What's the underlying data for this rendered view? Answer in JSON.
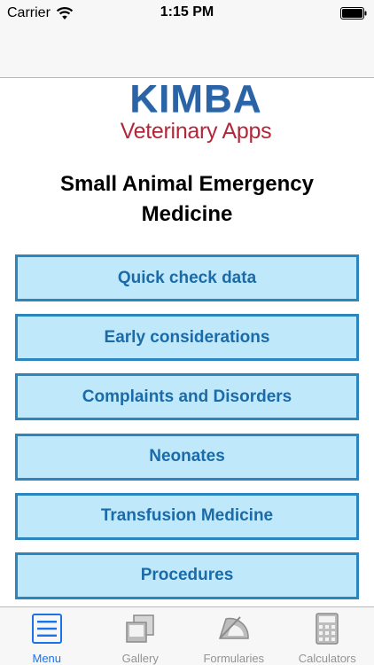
{
  "status": {
    "carrier": "Carrier",
    "time": "1:15 PM"
  },
  "logo": {
    "title": "KIMBA",
    "subtitle": "Veterinary Apps"
  },
  "heading": "Small Animal Emergency Medicine",
  "menu": [
    {
      "label": "Quick check data"
    },
    {
      "label": "Early considerations"
    },
    {
      "label": "Complaints and Disorders"
    },
    {
      "label": "Neonates"
    },
    {
      "label": "Transfusion Medicine"
    },
    {
      "label": "Procedures"
    }
  ],
  "tabs": [
    {
      "label": "Menu",
      "icon": "menu-icon",
      "active": true
    },
    {
      "label": "Gallery",
      "icon": "gallery-icon",
      "active": false
    },
    {
      "label": "Formularies",
      "icon": "protractor-icon",
      "active": false
    },
    {
      "label": "Calculators",
      "icon": "calculator-icon",
      "active": false
    }
  ],
  "colors": {
    "button_fill": "#bfe8fb",
    "button_border": "#2b86c0",
    "button_text": "#1b6ba8",
    "logo_blue": "#2a64a6",
    "logo_red": "#b2283a",
    "tab_active": "#1b73e8",
    "tab_inactive": "#939393"
  }
}
